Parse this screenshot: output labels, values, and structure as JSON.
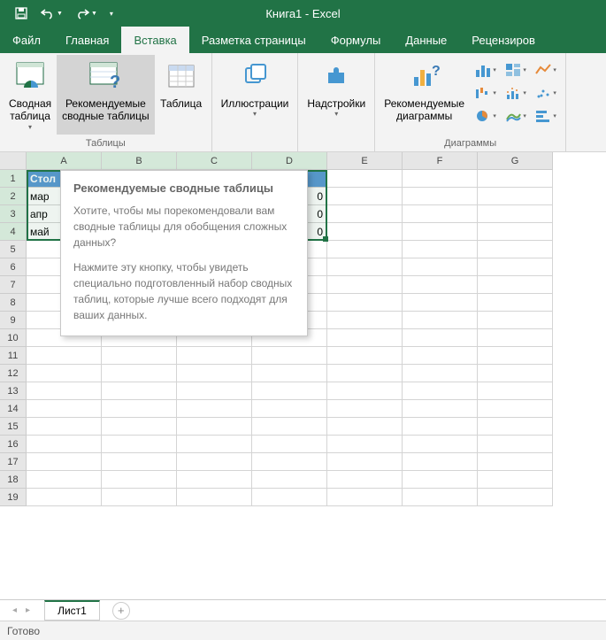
{
  "title": "Книга1 - Excel",
  "qat": {
    "save": "save-icon",
    "undo": "undo-icon",
    "redo": "redo-icon"
  },
  "tabs": [
    "Файл",
    "Главная",
    "Вставка",
    "Разметка страницы",
    "Формулы",
    "Данные",
    "Рецензиров"
  ],
  "active_tab_index": 2,
  "ribbon": {
    "tables_group_label": "Таблицы",
    "pivot_table": "Сводная\nтаблица",
    "recommended_pivot": "Рекомендуемые\nсводные таблицы",
    "table": "Таблица",
    "illustrations": "Иллюстрации",
    "addins": "Надстройки",
    "recommended_charts": "Рекомендуемые\nдиаграммы",
    "charts_group_label": "Диаграммы"
  },
  "tooltip": {
    "title": "Рекомендуемые сводные таблицы",
    "p1": "Хотите, чтобы мы порекомендовали вам сводные таблицы для обобщения сложных данных?",
    "p2": "Нажмите эту кнопку, чтобы увидеть специально подготовленный набор сводных таблиц, которые лучше всего подходят для ваших данных."
  },
  "columns": [
    "A",
    "B",
    "C",
    "D",
    "E",
    "F",
    "G"
  ],
  "rows_visible": 19,
  "cells": {
    "A1": "Стол",
    "A2": "мар",
    "A3": "апр",
    "A4": "май",
    "D2_suffix": "0",
    "D3_suffix": "0",
    "D4_suffix": "0"
  },
  "selection": {
    "top_row": 1,
    "bottom_row": 4,
    "left_col": 0,
    "right_col": 3
  },
  "sheet_tab": "Лист1",
  "status": "Готово"
}
